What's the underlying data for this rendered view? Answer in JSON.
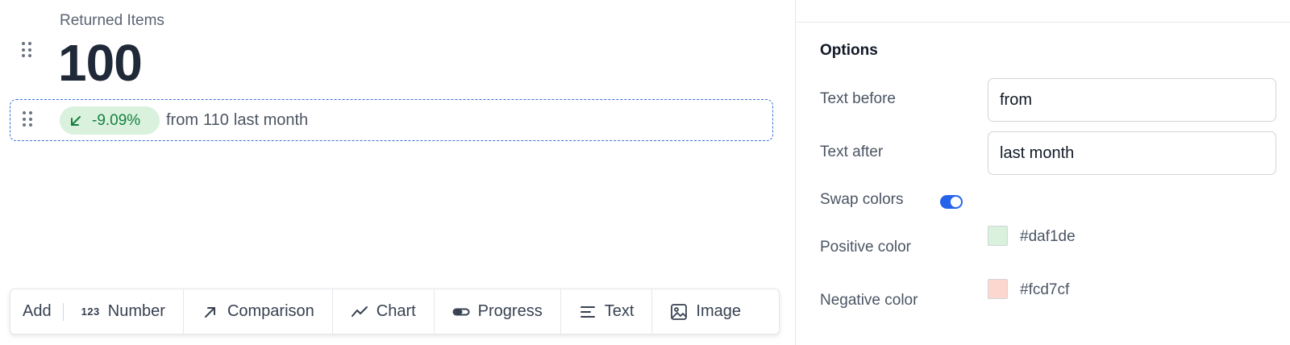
{
  "kpi": {
    "title": "Returned Items",
    "value": "100"
  },
  "comparison": {
    "delta": "-9.09%",
    "direction": "down",
    "text_before": "from",
    "previous_value": "110",
    "text_after": "last month",
    "badge_color": "#daf1de",
    "text_color": "#15803d"
  },
  "toolbar": {
    "add_label": "Add",
    "items": [
      {
        "label": "Number",
        "icon": "number-icon",
        "glyph": "123"
      },
      {
        "label": "Comparison",
        "icon": "arrow-up-right-icon"
      },
      {
        "label": "Chart",
        "icon": "line-chart-icon"
      },
      {
        "label": "Progress",
        "icon": "progress-icon"
      },
      {
        "label": "Text",
        "icon": "text-align-icon"
      },
      {
        "label": "Image",
        "icon": "image-icon"
      }
    ]
  },
  "panel": {
    "title": "Options",
    "text_before": {
      "label": "Text before",
      "value": "from"
    },
    "text_after": {
      "label": "Text after",
      "value": "last month"
    },
    "swap_colors": {
      "label": "Swap colors",
      "enabled": true,
      "accent": "#2563eb"
    },
    "positive_color": {
      "label": "Positive color",
      "value": "#daf1de"
    },
    "negative_color": {
      "label": "Negative color",
      "value": "#fcd7cf"
    }
  }
}
